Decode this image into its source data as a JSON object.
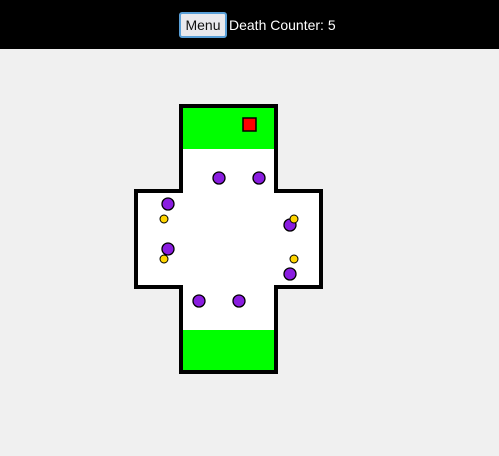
{
  "header": {
    "menu_label": "Menu",
    "death_counter_label": "Death Counter: ",
    "death_count": "5"
  },
  "game": {
    "colors": {
      "background": "#f0f0f0",
      "wall": "#000000",
      "floor": "#ffffff",
      "safe_zone": "#00ff00",
      "player": "#ff0000",
      "enemy": "#8a1de0",
      "coin": "#ffd500"
    },
    "player_icon": "red-square",
    "enemy_icon": "purple-circle",
    "coin_icon": "yellow-circle",
    "enemy_count": 8,
    "coin_count": 4
  }
}
